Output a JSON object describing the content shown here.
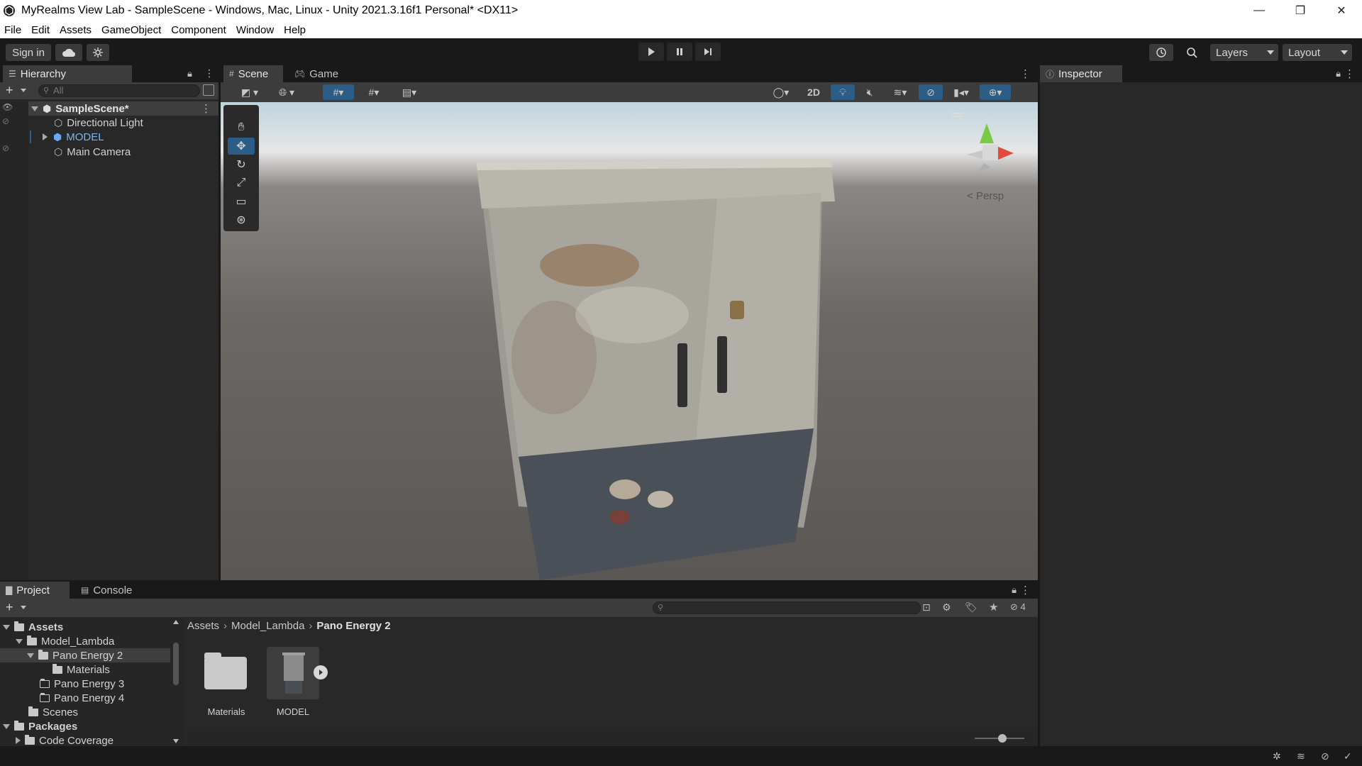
{
  "window": {
    "title": "MyRealms View Lab - SampleScene - Windows, Mac, Linux - Unity 2021.3.16f1 Personal* <DX11>",
    "controls": {
      "minimize": "—",
      "restore": "❐",
      "close": "✕"
    }
  },
  "menu": [
    "File",
    "Edit",
    "Assets",
    "GameObject",
    "Component",
    "Window",
    "Help"
  ],
  "toolbar": {
    "sign_in": "Sign in",
    "layers": "Layers",
    "layout": "Layout"
  },
  "hierarchy": {
    "tab": "Hierarchy",
    "search_placeholder": "All",
    "scene": "SampleScene*",
    "items": [
      {
        "label": "Directional Light"
      },
      {
        "label": "MODEL"
      },
      {
        "label": "Main Camera"
      }
    ]
  },
  "scene_view": {
    "tabs": [
      "Scene",
      "Game"
    ],
    "btn_2d": "2D",
    "projection": "Persp"
  },
  "inspector": {
    "tab": "Inspector"
  },
  "project": {
    "tabs": [
      "Project",
      "Console"
    ],
    "hidden_count": "4",
    "tree": [
      {
        "label": "Assets"
      },
      {
        "label": "Model_Lambda"
      },
      {
        "label": "Pano Energy 2"
      },
      {
        "label": "Materials"
      },
      {
        "label": "Pano Energy 3"
      },
      {
        "label": "Pano Energy 4"
      },
      {
        "label": "Scenes"
      },
      {
        "label": "Packages"
      },
      {
        "label": "Code Coverage"
      }
    ],
    "breadcrumb": [
      "Assets",
      "Model_Lambda",
      "Pano Energy 2"
    ],
    "assets": [
      {
        "label": "Materials"
      },
      {
        "label": "MODEL"
      }
    ]
  },
  "colors": {
    "accent_blue": "#2c5d87",
    "model_text": "#7fb2f0"
  }
}
